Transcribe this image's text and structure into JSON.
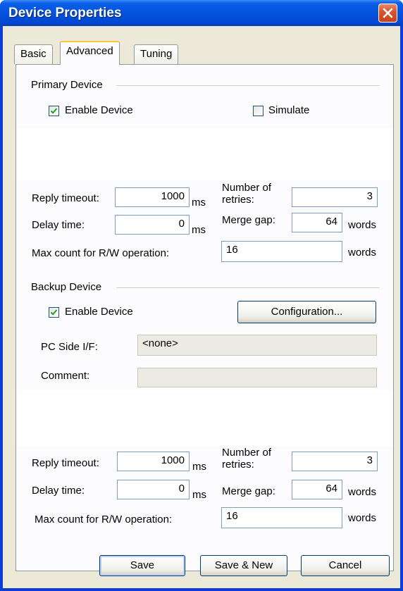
{
  "window": {
    "title": "Device Properties"
  },
  "tabs": [
    "Basic",
    "Advanced",
    "Tuning"
  ],
  "primary": {
    "heading": "Primary Device",
    "enable_label": "Enable Device",
    "enable_checked": true,
    "simulate_label": "Simulate",
    "simulate_checked": false,
    "reply_timeout_label": "Reply timeout:",
    "reply_timeout_value": "1000",
    "ms": "ms",
    "retries_label_1": "Number of",
    "retries_label_2": "retries:",
    "retries_value": "3",
    "delay_label": "Delay time:",
    "delay_value": "0",
    "merge_label": "Merge gap:",
    "merge_value": "64",
    "words": "words",
    "max_label": "Max count for R/W operation:",
    "max_value": "16"
  },
  "backup": {
    "heading": "Backup Device",
    "enable_label": "Enable Device",
    "enable_checked": true,
    "config_button": "Configuration...",
    "pc_side_label": "PC Side I/F:",
    "pc_side_value": "<none>",
    "comment_label": "Comment:",
    "comment_value": "",
    "reply_timeout_label": "Reply timeout:",
    "reply_timeout_value": "1000",
    "ms": "ms",
    "retries_label_1": "Number of",
    "retries_label_2": "retries:",
    "retries_value": "3",
    "delay_label": "Delay time:",
    "delay_value": "0",
    "merge_label": "Merge gap:",
    "merge_value": "64",
    "words": "words",
    "max_label": "Max count for R/W operation:",
    "max_value": "16"
  },
  "buttons": {
    "save": "Save",
    "save_new": "Save & New",
    "cancel": "Cancel"
  },
  "colors": {
    "titlebar": "#0454e0",
    "face": "#ece9d8",
    "tab_highlight": "#ffc83c",
    "close": "#d8562e"
  }
}
